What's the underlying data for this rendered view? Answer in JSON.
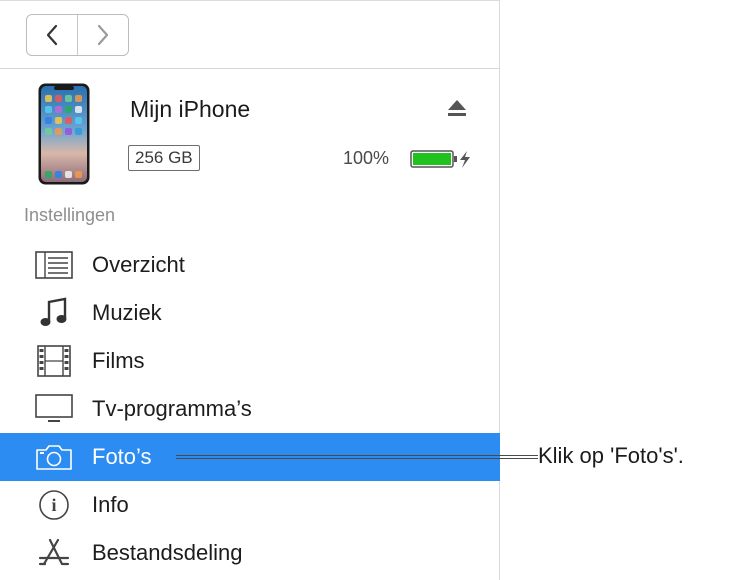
{
  "nav": {
    "back_icon": "chevron-left-icon",
    "forward_icon": "chevron-right-icon"
  },
  "device": {
    "name": "Mijn iPhone",
    "capacity": "256 GB",
    "battery_percent": "100%",
    "battery_level": 1.0,
    "charging": true,
    "battery_color": "#1fc21f",
    "eject_icon": "eject-icon"
  },
  "settings": {
    "heading": "Instellingen",
    "items": [
      {
        "label": "Overzicht",
        "icon": "summary-list-icon",
        "selected": false
      },
      {
        "label": "Muziek",
        "icon": "music-note-icon",
        "selected": false
      },
      {
        "label": "Films",
        "icon": "film-strip-icon",
        "selected": false
      },
      {
        "label": "Tv-programma’s",
        "icon": "tv-monitor-icon",
        "selected": false
      },
      {
        "label": "Foto’s",
        "icon": "camera-icon",
        "selected": true
      },
      {
        "label": "Info",
        "icon": "info-icon",
        "selected": false
      },
      {
        "label": "Bestandsdeling",
        "icon": "app-store-icon",
        "selected": false
      }
    ],
    "selected_color": "#2c8cf2"
  },
  "callout": {
    "text": "Klik op 'Foto's'."
  }
}
